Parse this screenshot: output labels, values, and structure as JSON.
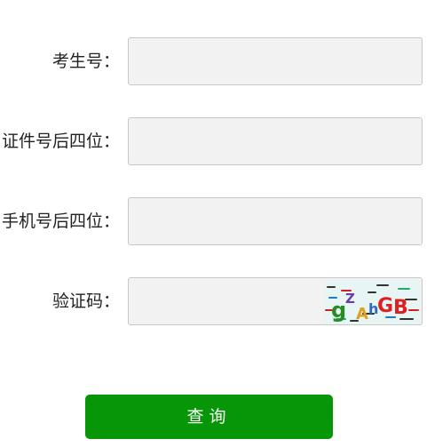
{
  "form": {
    "fields": [
      {
        "label": "考生号：",
        "value": "",
        "placeholder": ""
      },
      {
        "label": "证件号后四位：",
        "value": "",
        "placeholder": ""
      },
      {
        "label": "手机号后四位：",
        "value": "",
        "placeholder": ""
      },
      {
        "label": "验证码：",
        "value": "",
        "placeholder": ""
      }
    ],
    "captcha": {
      "text": "gZAhGB"
    },
    "submit_label": "查询"
  },
  "colors": {
    "submit_bg": "#079607",
    "input_bg": "#f2f2f2",
    "input_border": "#c8c8c8",
    "captcha_bg": "#eaf6f6"
  }
}
